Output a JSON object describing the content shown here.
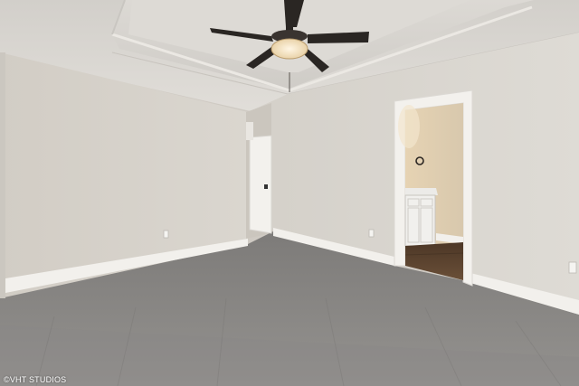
{
  "photo": {
    "subject": "empty-bedroom",
    "watermark": {
      "symbol": "©",
      "text": "VHT STUDIOS"
    },
    "colors": {
      "wall": "#d6d2cb",
      "ceiling": "#d9d6d1",
      "carpet": "#8d8b89",
      "trim": "#f4f2ee",
      "wood_floor": "#5b4431",
      "fan_blade": "#2a2623",
      "fan_light": "#f3e2c3"
    }
  }
}
